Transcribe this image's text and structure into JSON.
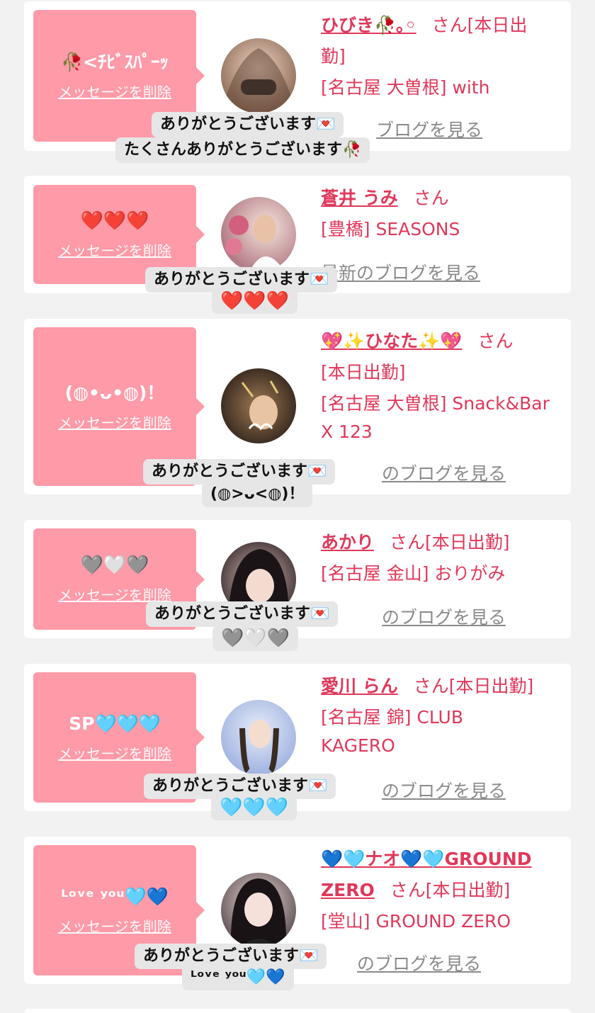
{
  "common": {
    "delete_label": "メッセージを削除",
    "blog_label": "最新のブログを見る",
    "blog_label_short": "のブログを見る",
    "blog_label_partial": "ブログを見る",
    "thanks": "ありがとうございます💌"
  },
  "cards": [
    {
      "message": "🥀<ﾁﾋﾞｽﾊﾟｰｯ",
      "name": "ひびき🥀｡◦",
      "suffix": "さん[本日出",
      "suffix2": "勤]",
      "store": "[名古屋 大曽根] with",
      "sticker_line2": "たくさんありがとうございます🥀"
    },
    {
      "message": "❤️❤️❤️",
      "name": "蒼井 うみ",
      "suffix": "さん",
      "store": "[豊橋] SEASONS",
      "sticker_line2": "❤️❤️❤️"
    },
    {
      "message": "(◍•ᴗ•◍)！",
      "name": "💖✨ひなた✨💖",
      "suffix": "さん",
      "suffix2": "[本日出勤]",
      "store": "[名古屋 大曽根] Snack&Bar",
      "store2": "X 123",
      "sticker_line2": "(◍>ᴗ<◍)！"
    },
    {
      "message": "🩶🤍🩶",
      "name": "あかり",
      "suffix": "さん[本日出勤]",
      "store": "[名古屋 金山] おりがみ",
      "sticker_line2": "🩶🤍🩶"
    },
    {
      "message": "SP🩵🩵🩵",
      "name": "愛川 らん",
      "suffix": "さん[本日出勤]",
      "store": "[名古屋 錦] CLUB",
      "store2": "KAGERO",
      "sticker_line2": "🩵🩵🩵"
    },
    {
      "message": "ᴸᵒᵛᵉ ʸᵒᵘ🩵💙",
      "name": "💙🩵ナオ💙🩵GROUND",
      "name2": "ZERO",
      "suffix": "さん[本日出勤]",
      "store": "[堂山] GROUND ZERO",
      "sticker_line2": "ᴸᵒᵛᵉ ʸᵒᵘ🩵💙"
    }
  ]
}
